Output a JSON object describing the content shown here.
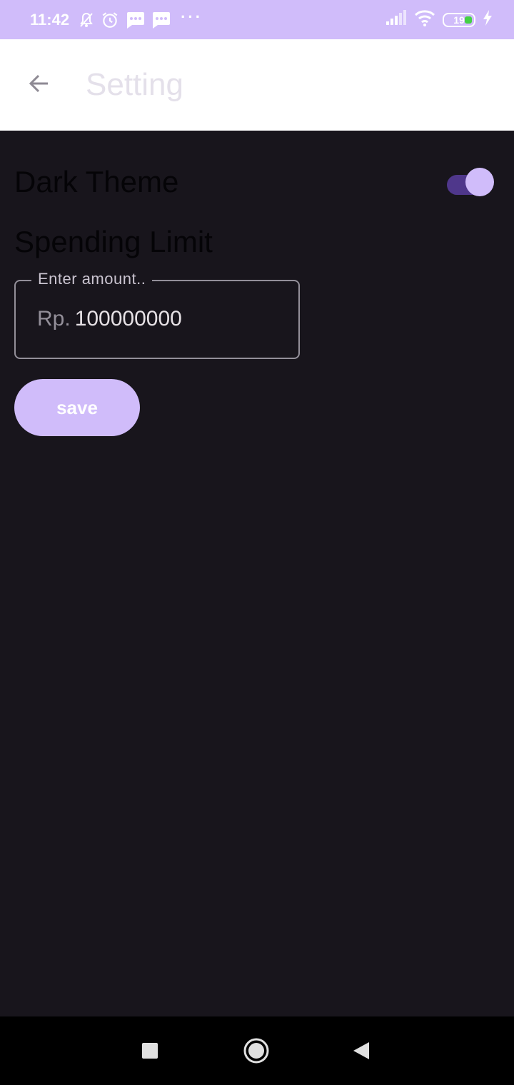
{
  "status_bar": {
    "time": "11:42",
    "more": "···",
    "battery_level": "19",
    "icons": [
      "bell-off-icon",
      "alarm-icon",
      "message-icon",
      "message-icon",
      "signal-icon",
      "wifi-icon",
      "battery-icon",
      "charging-icon"
    ]
  },
  "app_bar": {
    "title": "Setting",
    "back_icon": "arrow-left-icon"
  },
  "settings": {
    "dark_theme_label": "Dark Theme",
    "dark_theme_enabled": true,
    "spending_limit_label": "Spending Limit",
    "amount_field": {
      "label": "Enter amount..",
      "prefix": "Rp.",
      "value": "100000000"
    },
    "save_label": "save"
  },
  "nav_bar": {
    "icons": [
      "recent-apps-icon",
      "home-icon",
      "back-icon"
    ]
  },
  "colors": {
    "accent": "#d0bcfa",
    "toggle_track": "#4f378b",
    "background": "#18151c",
    "app_bar": "#ffffff"
  }
}
